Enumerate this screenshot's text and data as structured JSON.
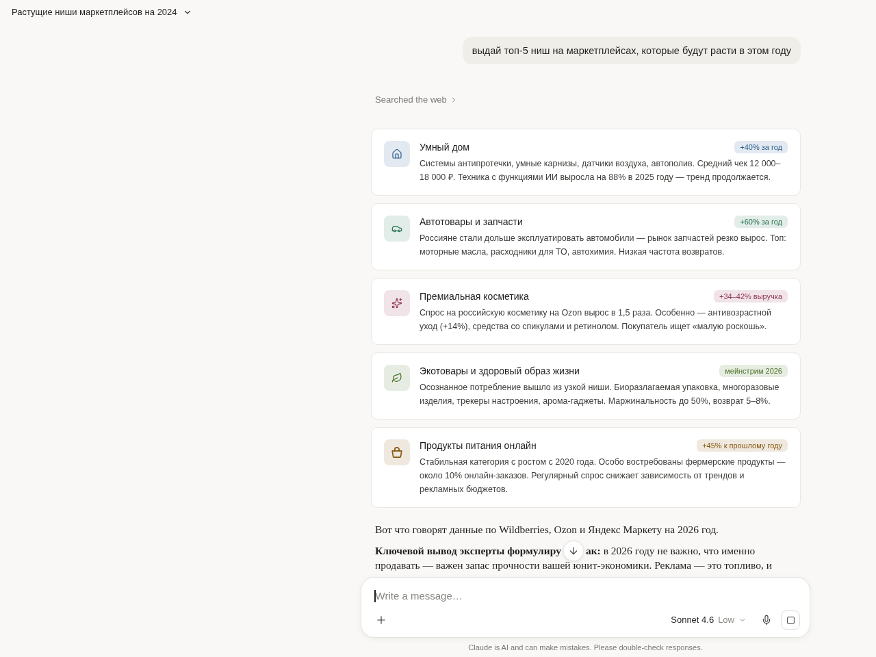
{
  "header": {
    "title": "Растущие ниши маркетплейсов на 2024"
  },
  "user_message": {
    "text": "выдай топ-5 ниш на маркетплейсах, которые будут расти в этом году"
  },
  "search_step": {
    "label": "Searched the web"
  },
  "niches": [
    {
      "title": "Умный дом",
      "badge": "+40% за год",
      "color": "#2a5d8f",
      "description": "Системы антипротечки, умные карнизы, датчики воздуха, автополив. Средний чек 12 000–18 000 ₽. Техника с функциями ИИ выросла на 88% в 2025 году — тренд продолжается."
    },
    {
      "title": "Автотовары и запчасти",
      "badge": "+60% за год",
      "color": "#23704f",
      "description": "Россияне стали дольше эксплуатировать автомобили — рынок запчастей резко вырос. Топ: моторные масла, расходники для ТО, автохимия. Низкая частота возвратов."
    },
    {
      "title": "Премиальная косметика",
      "badge": "+34–42% выручка",
      "color": "#923356",
      "description": "Спрос на российскую косметику на Ozon вырос в 1,5 раза. Особенно — антивозрастной уход (+14%), средства со спикулами и ретинолом. Покупатель ищет «малую роскошь»."
    },
    {
      "title": "Экотовары и здоровый образ жизни",
      "badge": "мейнстрим 2026",
      "color": "#4a7426",
      "description": "Осознанное потребление вышло из узкой ниши. Биоразлагаемая упаковка, многоразовые изделия, трекеры настроения, арома-гаджеты. Маржинальность до 50%, возврат 5–8%."
    },
    {
      "title": "Продукты питания онлайн",
      "badge": "+45% к прошлому году",
      "color": "#85560f",
      "description": "Стабильная категория с ростом с 2020 года. Особо востребованы фермерские продукты — около 10% онлайн-заказов. Регулярный спрос снижает зависимость от трендов и рекламных бюджетов."
    }
  ],
  "intro_paragraph": "Вот что говорят данные по Wildberries, Ozon и Яндекс Маркету на 2026 год.",
  "summary_paragraph": {
    "first_line_start": "Ключевой вывод эксперты формулиру",
    "first_line_end": "**ак:** в 2026 году не важно, что именно",
    "second_line": "продавать — важен запас прочности вашей юнит-экономики. Реклама — это топливо, и"
  },
  "composer": {
    "placeholder": "Write a message…",
    "model": "Sonnet 4.6",
    "effort": "Low"
  },
  "disclaimer": "Claude is AI and can make mistakes. Please double-check responses."
}
